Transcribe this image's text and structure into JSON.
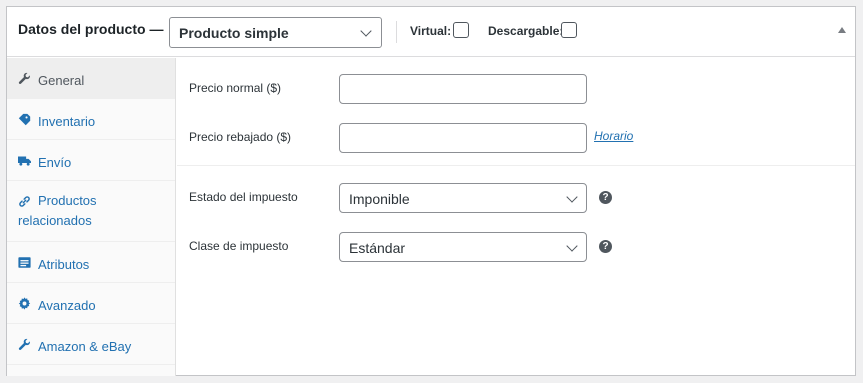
{
  "header": {
    "title": "Datos del producto —",
    "product_type": {
      "selected": "Producto simple"
    },
    "virtual_label": "Virtual:",
    "downloadable_label": "Descargable:"
  },
  "sidebar": {
    "items": [
      {
        "label": "General",
        "icon": "wrench-icon",
        "active": true
      },
      {
        "label": "Inventario",
        "icon": "tag-icon"
      },
      {
        "label": "Envío",
        "icon": "truck-icon"
      },
      {
        "label": "Productos relacionados",
        "icon": "link-icon"
      },
      {
        "label": "Atributos",
        "icon": "list-icon"
      },
      {
        "label": "Avanzado",
        "icon": "gear-icon"
      },
      {
        "label": "Amazon & eBay",
        "icon": "wrench-icon"
      }
    ]
  },
  "general": {
    "regular_price": {
      "label": "Precio normal ($)",
      "value": ""
    },
    "sale_price": {
      "label": "Precio rebajado ($)",
      "value": "",
      "schedule_link": "Horario"
    },
    "tax_status": {
      "label": "Estado del impuesto",
      "selected": "Imponible",
      "help": "?"
    },
    "tax_class": {
      "label": "Clase de impuesto",
      "selected": "Estándar",
      "help": "?"
    }
  },
  "colors": {
    "link": "#2271b1",
    "border": "#8c8f94",
    "active_tab": "#eeeeee"
  }
}
